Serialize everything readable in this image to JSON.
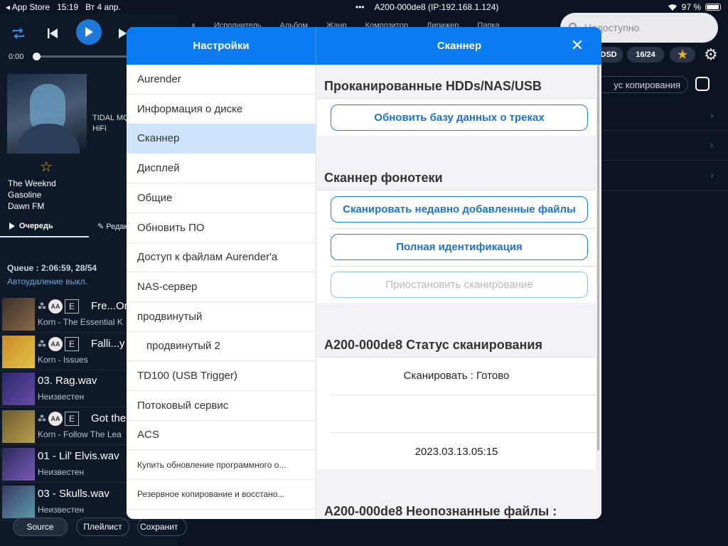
{
  "status_bar": {
    "back_app": "◂ App Store",
    "time": "15:19",
    "date": "Вт 4 апр.",
    "dots": "•••",
    "device": "A200-000de8 (IP:192.168.1.124)",
    "battery": "97 %"
  },
  "player": {
    "elapsed": "0:00",
    "source_label": "TIDAL MQ",
    "quality": "HiFi",
    "artist": "The Weeknd",
    "track": "Gasoline",
    "album": "Dawn FM",
    "queue_tab": "Очередь",
    "edit_tab": "Редакт",
    "queue_info": "Queue :  2:06:59, 28/54",
    "auto_delete": "Автоудаление выкл."
  },
  "queue": [
    {
      "title": "Fre...Or",
      "subtitle": "Korn - The Essential K",
      "badges": true,
      "colors": [
        "#3b2f2a",
        "#8a6a4a"
      ]
    },
    {
      "title": "Falli...y",
      "subtitle": "Korn - Issues",
      "badges": true,
      "colors": [
        "#c98a2a",
        "#e3c24a"
      ]
    },
    {
      "title": "03. Rag.wav",
      "subtitle": "Неизвестен",
      "badges": false,
      "colors": [
        "#2a2a6a",
        "#6a4aa8"
      ]
    },
    {
      "title": "Got the",
      "subtitle": "Korn - Follow The Lea",
      "badges": true,
      "colors": [
        "#6a5a2a",
        "#b8a050"
      ]
    },
    {
      "title": "01 - Lil' Elvis.wav",
      "subtitle": "Неизвестен",
      "badges": false,
      "colors": [
        "#2a2a5a",
        "#7a5ab8"
      ]
    },
    {
      "title": "03 - Skulls.wav",
      "subtitle": "Неизвестен",
      "badges": false,
      "colors": [
        "#3a3a6a",
        "#5a9aa8"
      ]
    }
  ],
  "bottom": {
    "source": "Source",
    "playlist": "Плейлист",
    "save": "Сохранит"
  },
  "top_menu": [
    "к",
    "Исполнитель",
    "Альбом",
    "Жанр",
    "Композитор",
    "Дирижер",
    "Папка"
  ],
  "search": {
    "placeholder": "Недоступно"
  },
  "chips": {
    "dsd": "DSD",
    "bits": "16/24"
  },
  "copy_status": "ус копирования",
  "modal": {
    "left_title": "Настройки",
    "right_title": "Сканнер",
    "menu": [
      {
        "label": "Aurender"
      },
      {
        "label": "Информация о диске"
      },
      {
        "label": "Сканнер",
        "active": true
      },
      {
        "label": "Дисплей"
      },
      {
        "label": "Общие"
      },
      {
        "label": "Обновить ПО"
      },
      {
        "label": "Доступ к файлам Aurender'a"
      },
      {
        "label": "NAS-сервер"
      },
      {
        "label": "продвинутый"
      },
      {
        "label": "продвинутый 2",
        "indent": true
      },
      {
        "label": "TD100 (USB Trigger)"
      },
      {
        "label": "Потоковый сервис"
      },
      {
        "label": "ACS"
      },
      {
        "label": "Купить обновление программного о...",
        "small": true
      },
      {
        "label": "Резервное копирование и восстано...",
        "small": true
      }
    ],
    "scanned_header": "Проканированные HDDs/NAS/USB",
    "update_db": "Обновить базу данных о треках",
    "library_header": "Сканнер фонотеки",
    "scan_recent": "Сканировать недавно добавленные файлы",
    "full_id": "Полная идентификация",
    "pause_scan": "Приостановить сканирование",
    "status_header": "A200-000de8 Статус сканирования",
    "scan_status": "Сканировать : Готово",
    "scan_date": "2023.03.13.05:15",
    "unknown_header": "A200-000de8 Неопознанные файлы :"
  }
}
